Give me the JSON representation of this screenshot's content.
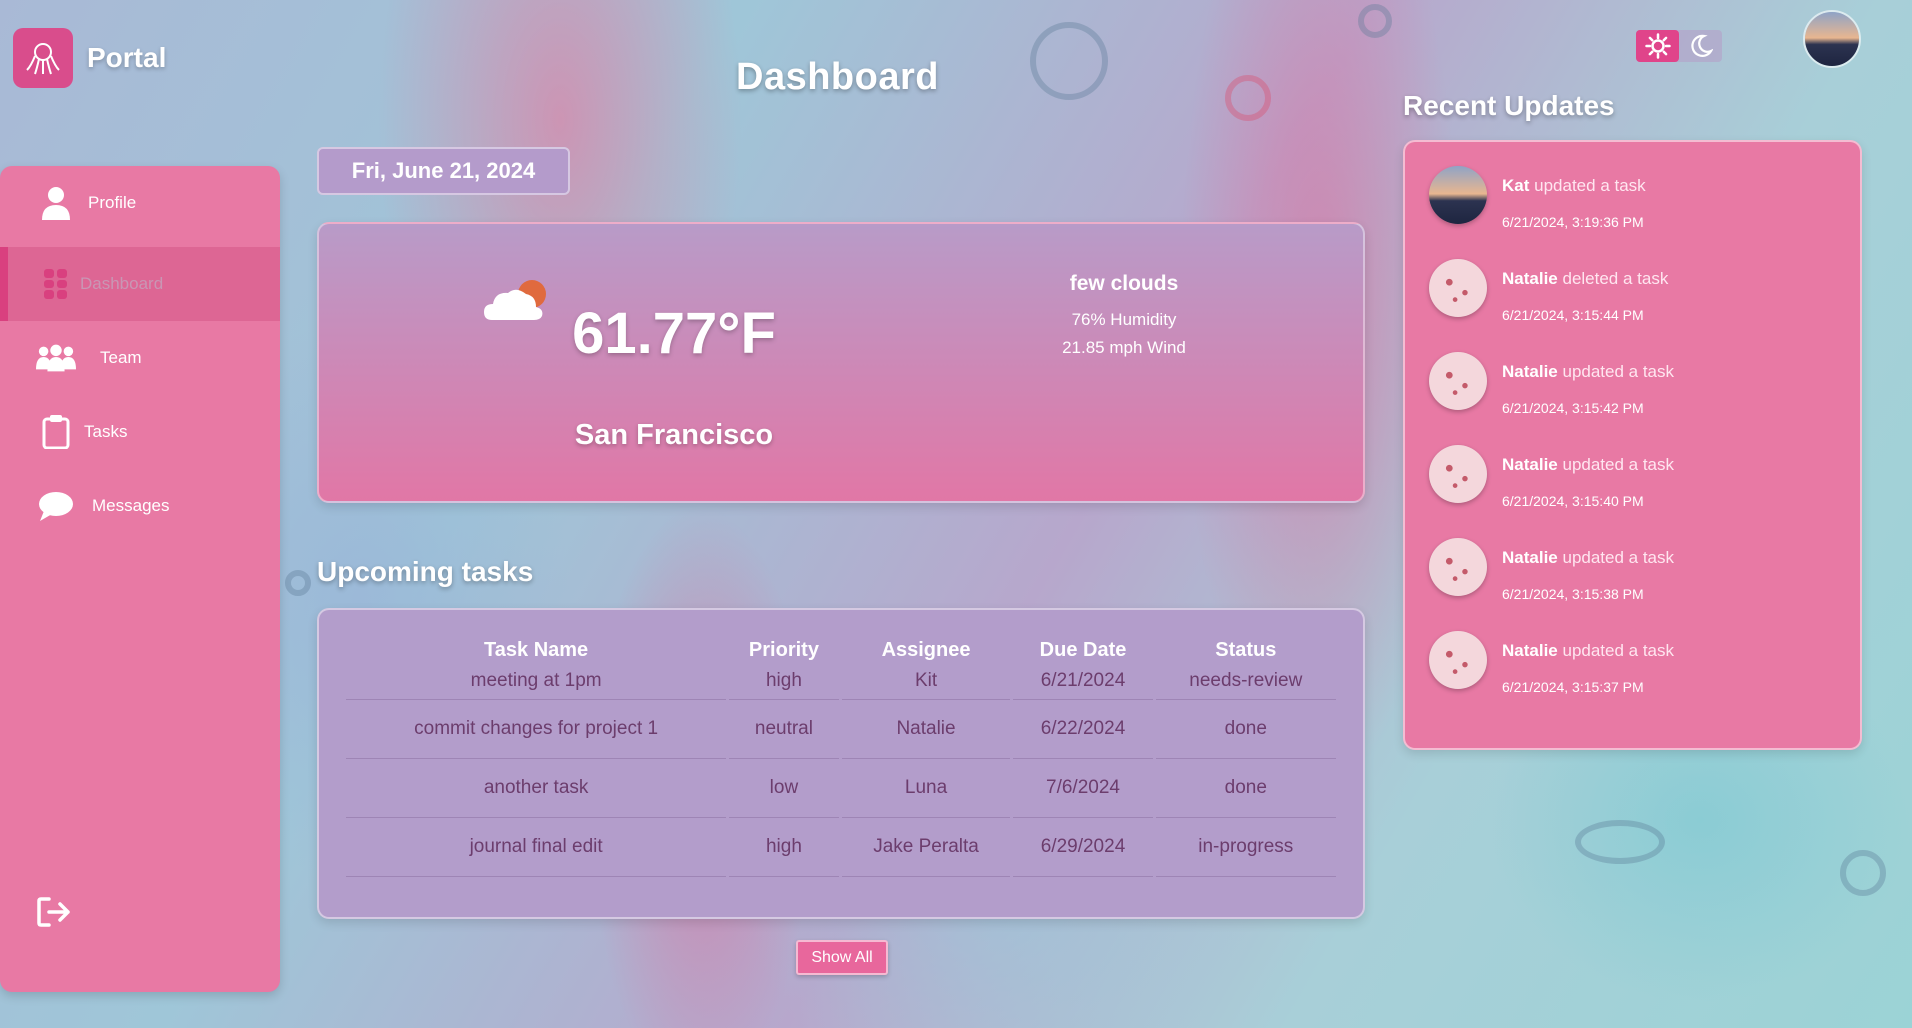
{
  "brand": {
    "name": "Portal",
    "logo_icon": "octopus-logo-icon"
  },
  "sidebar": {
    "items": [
      {
        "label": "Profile",
        "icon": "user-icon",
        "active": false
      },
      {
        "label": "Dashboard",
        "icon": "dashboard-grid-icon",
        "active": true
      },
      {
        "label": "Team",
        "icon": "team-icon",
        "active": false
      },
      {
        "label": "Tasks",
        "icon": "clipboard-icon",
        "active": false
      },
      {
        "label": "Messages",
        "icon": "chat-bubble-icon",
        "active": false
      }
    ],
    "logout_icon": "logout-icon"
  },
  "header": {
    "title": "Dashboard"
  },
  "date": "Fri, June 21, 2024",
  "weather": {
    "temp": "61.77°F",
    "city": "San Francisco",
    "description": "few clouds",
    "humidity": "76% Humidity",
    "wind": "21.85 mph Wind",
    "icon": "partly-cloudy-icon"
  },
  "tasks": {
    "title": "Upcoming tasks",
    "columns": [
      "Task Name",
      "Priority",
      "Assignee",
      "Due Date",
      "Status"
    ],
    "rows": [
      [
        "meeting at 1pm",
        "high",
        "Kit",
        "6/21/2024",
        "needs-review"
      ],
      [
        "commit changes for project 1",
        "neutral",
        "Natalie",
        "6/22/2024",
        "done"
      ],
      [
        "another task",
        "low",
        "Luna",
        "7/6/2024",
        "done"
      ],
      [
        "journal final edit",
        "high",
        "Jake Peralta",
        "6/29/2024",
        "in-progress"
      ]
    ],
    "show_all_label": "Show All"
  },
  "theme": {
    "light_icon": "sun-icon",
    "dark_icon": "moon-icon"
  },
  "updates": {
    "title": "Recent Updates",
    "items": [
      {
        "user": "Kat",
        "action": "updated a task",
        "time": "6/21/2024, 3:19:36 PM"
      },
      {
        "user": "Natalie",
        "action": "deleted a task",
        "time": "6/21/2024, 3:15:44 PM"
      },
      {
        "user": "Natalie",
        "action": "updated a task",
        "time": "6/21/2024, 3:15:42 PM"
      },
      {
        "user": "Natalie",
        "action": "updated a task",
        "time": "6/21/2024, 3:15:40 PM"
      },
      {
        "user": "Natalie",
        "action": "updated a task",
        "time": "6/21/2024, 3:15:38 PM"
      },
      {
        "user": "Natalie",
        "action": "updated a task",
        "time": "6/21/2024, 3:15:37 PM"
      }
    ]
  },
  "colors": {
    "accent": "#e879a4",
    "active": "#d9407f",
    "table_bg": "#b39dcb",
    "cell_text": "#6c3d6d"
  }
}
